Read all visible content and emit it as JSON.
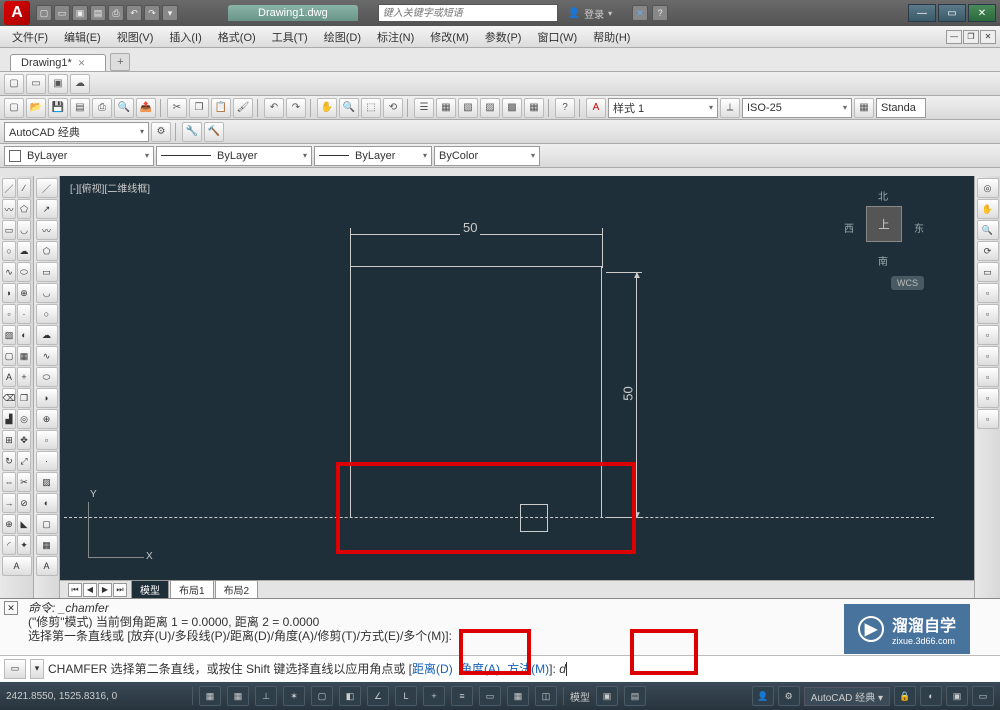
{
  "title": {
    "doc_name": "Drawing1.dwg",
    "search_placeholder": "键入关键字或短语",
    "login": "登录"
  },
  "menu": {
    "items": [
      "文件(F)",
      "编辑(E)",
      "视图(V)",
      "插入(I)",
      "格式(O)",
      "工具(T)",
      "绘图(D)",
      "标注(N)",
      "修改(M)",
      "参数(P)",
      "窗口(W)",
      "帮助(H)"
    ]
  },
  "doc_tab": {
    "name": "Drawing1*"
  },
  "workspace_dd": "AutoCAD 经典",
  "style_dd": "样式 1",
  "dimstyle_dd": "ISO-25",
  "standard_dd": "Standa",
  "layer": {
    "name": "ByLayer",
    "linetype": "ByLayer",
    "lineweight": "ByLayer",
    "color": "ByColor"
  },
  "view": {
    "label": "[-][俯视][二维线框]",
    "cube_top": "上",
    "cube_n": "北",
    "cube_s": "南",
    "cube_e": "东",
    "cube_w": "西",
    "wcs": "WCS",
    "ucs_x": "X",
    "ucs_y": "Y"
  },
  "drawing": {
    "dim_h": "50",
    "dim_v": "50"
  },
  "model_tabs": {
    "model": "模型",
    "layout1": "布局1",
    "layout2": "布局2"
  },
  "cmd": {
    "line1": "命令:  _chamfer",
    "line2": "(\"修剪\"模式) 当前倒角距离 1 = 0.0000, 距离 2 = 0.0000",
    "line3_a": "选择第一条直线或 [放弃(U)/多段线(P)/距离(D)/角度(A)/修剪(T)/方式(E)/多个(M)]:",
    "prompt_prefix": "CHAMFER 选择第二条直线，或按住 Shift 键选择直线以应用角点或 [",
    "opt1": "距离(D)",
    "opt2": "角度(A)",
    "opt3": "方法(M)",
    "prompt_suffix": "]: ",
    "input": "d"
  },
  "status": {
    "coords": "2421.8550, 1525.8316, 0",
    "model": "模型",
    "ws": "AutoCAD 经典"
  },
  "watermark": {
    "brand": "溜溜自学",
    "url": "zixue.3d66.com"
  }
}
